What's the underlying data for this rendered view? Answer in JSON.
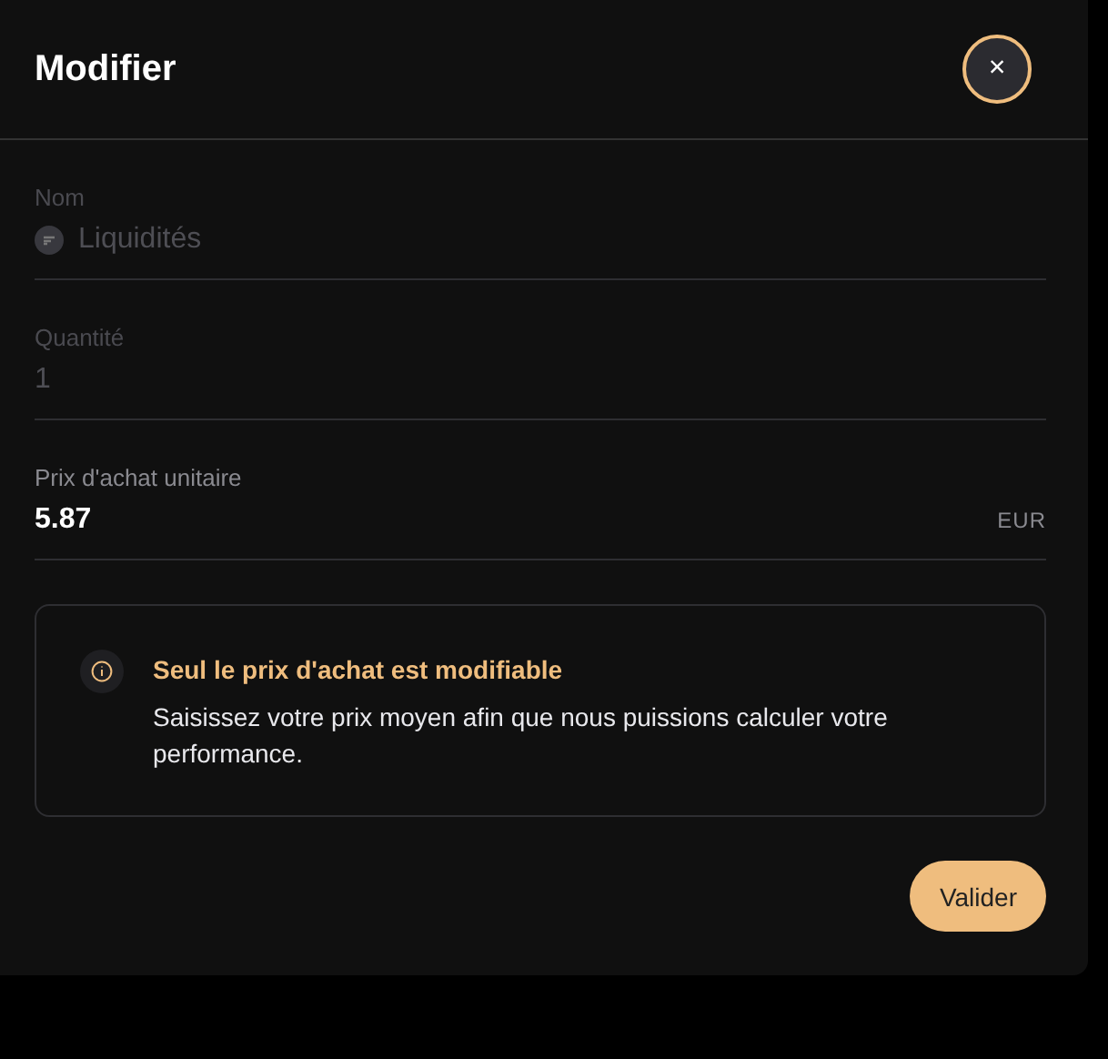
{
  "dialog": {
    "title": "Modifier",
    "close_label": "×"
  },
  "fields": [
    {
      "label": "Nom",
      "value": "Liquidités",
      "disabled": true,
      "kind": "asset"
    },
    {
      "label": "Quantité",
      "value": "1",
      "disabled": true,
      "kind": "text"
    },
    {
      "label": "Prix d'achat unitaire",
      "value": "5.87",
      "disabled": false,
      "kind": "amount",
      "unit": "EUR"
    }
  ],
  "notice": {
    "title": "Seul le prix d'achat est modifiable",
    "text": "Saisissez votre prix moyen afin que nous puissions calculer votre performance."
  },
  "buttons": [
    {
      "label": "Valider"
    }
  ]
}
